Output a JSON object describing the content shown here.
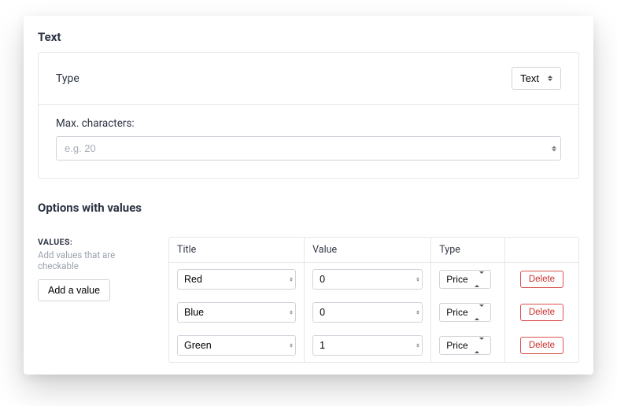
{
  "text_section": {
    "heading": "Text",
    "type_label": "Type",
    "type_select_value": "Text",
    "max_chars_label": "Max. characters:",
    "max_chars_placeholder": "e.g. 20",
    "max_chars_value": ""
  },
  "options_section": {
    "heading": "Options with values",
    "values_caption": "VALUES:",
    "values_hint": "Add values that are checkable",
    "add_button_label": "Add a value",
    "columns": {
      "title": "Title",
      "value": "Value",
      "type": "Type",
      "actions": ""
    },
    "type_dropdown_value": "Price",
    "delete_label": "Delete",
    "rows": [
      {
        "title": "Red",
        "value": "0",
        "type": "Price"
      },
      {
        "title": "Blue",
        "value": "0",
        "type": "Price"
      },
      {
        "title": "Green",
        "value": "1",
        "type": "Price"
      }
    ]
  },
  "colors": {
    "danger": "#c9302c"
  }
}
